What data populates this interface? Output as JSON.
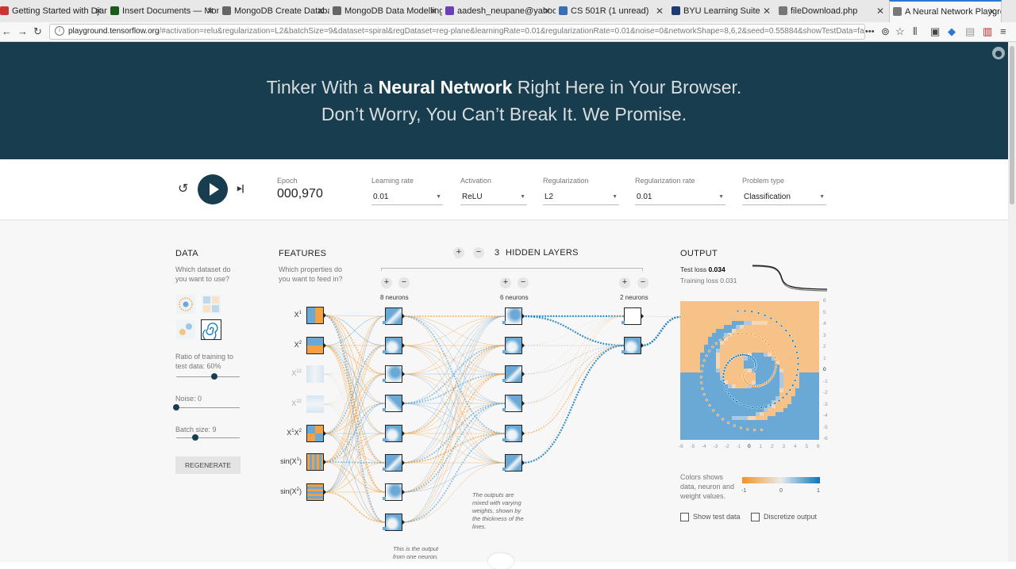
{
  "browser": {
    "tabs": [
      {
        "title": "Getting Started with Djang",
        "color": "#c33"
      },
      {
        "title": "Insert Documents — Mong",
        "color": "#1a5b1a"
      },
      {
        "title": "MongoDB Create Databas",
        "color": "#666"
      },
      {
        "title": "MongoDB Data Modelling",
        "color": "#666"
      },
      {
        "title": "aadesh_neupane@yahoo.c",
        "color": "#6b3fb5"
      },
      {
        "title": "CS 501R (1 unread)",
        "color": "#3b6db3"
      },
      {
        "title": "BYU Learning Suite",
        "color": "#1d3b70"
      },
      {
        "title": "fileDownload.php",
        "color": "#777"
      },
      {
        "title": "A Neural Network Playgro",
        "color": "#777"
      }
    ],
    "url_host": "playground.tensorflow.org",
    "url_rest": "/#activation=relu&regularization=L2&batchSize=9&dataset=spiral&regDataset=reg-plane&learningRate=0.01&regularizationRate=0.01&noise=0&networkShape=8,6,2&seed=0.55884&showTestData=false&discretize=false&percTrain"
  },
  "hero": {
    "line1_pre": "Tinker With a ",
    "line1_bold": "Neural Network",
    "line1_post": " Right Here in Your Browser.",
    "line2": "Don’t Worry, You Can’t Break It. We Promise."
  },
  "controls": {
    "epoch_label": "Epoch",
    "epoch_value": "000,970",
    "learning_rate": {
      "label": "Learning rate",
      "value": "0.01"
    },
    "activation": {
      "label": "Activation",
      "value": "ReLU"
    },
    "regularization": {
      "label": "Regularization",
      "value": "L2"
    },
    "regularization_rate": {
      "label": "Regularization rate",
      "value": "0.01"
    },
    "problem_type": {
      "label": "Problem type",
      "value": "Classification"
    }
  },
  "data_panel": {
    "title": "DATA",
    "question": "Which dataset do you want to use?",
    "ratio_label": "Ratio of training to test data:  60%",
    "ratio_value": 0.6,
    "noise_label": "Noise:  0",
    "noise_value": 0,
    "batch_label": "Batch size:  9",
    "batch_value": 0.3,
    "regenerate": "REGENERATE"
  },
  "features_panel": {
    "title": "FEATURES",
    "question": "Which properties do you want to feed in?",
    "features": [
      {
        "main": "X",
        "sup": "1",
        "tail": "",
        "sup2": "",
        "active": true
      },
      {
        "main": "X",
        "sup": "2",
        "tail": "",
        "sup2": "",
        "active": true
      },
      {
        "main": "X",
        "sup": "12",
        "tail": "",
        "sup2": "",
        "active": false
      },
      {
        "main": "X",
        "sup": "22",
        "tail": "",
        "sup2": "",
        "active": false
      },
      {
        "main": "X",
        "sup": "1",
        "tail": "X",
        "sup2": "2",
        "active": true
      },
      {
        "main": "sin(X",
        "sup": "1",
        "tail": ")",
        "sup2": "",
        "active": true
      },
      {
        "main": "sin(X",
        "sup": "2",
        "tail": ")",
        "sup2": "",
        "active": true
      }
    ]
  },
  "network": {
    "hidden_layers_count": "3",
    "hidden_layers_label": "HIDDEN LAYERS",
    "plus": "+",
    "minus": "−",
    "layers": [
      {
        "label": "8 neurons",
        "count": 8
      },
      {
        "label": "6 neurons",
        "count": 6
      },
      {
        "label": "2 neurons",
        "count": 2
      }
    ],
    "note_outputs": "The outputs are mixed with varying weights, shown by the thickness of the lines.",
    "note_neuron": "This is the output from one neuron."
  },
  "output_panel": {
    "title": "OUTPUT",
    "test_loss_label": "Test loss ",
    "test_loss": "0.034",
    "training_loss_label": "Training loss ",
    "training_loss": "0.031",
    "y_ticks": [
      "6",
      "5",
      "4",
      "3",
      "2",
      "1",
      "0",
      "-1",
      "-2",
      "-3",
      "-4",
      "-5",
      "-6"
    ],
    "x_ticks": [
      "-6",
      "-5",
      "-4",
      "-3",
      "-2",
      "-1",
      "0",
      "1",
      "2",
      "3",
      "4",
      "5",
      "6"
    ],
    "legend_text": "Colors shows data, neuron and weight values.",
    "legend_min": "-1",
    "legend_mid": "0",
    "legend_max": "1",
    "show_test_data": "Show test data",
    "discretize_output": "Discretize output"
  },
  "colors": {
    "header_bg": "#183d4e",
    "orange": "#f5a142",
    "blue": "#0877bd",
    "light_blue": "#6aa8d6",
    "light_orange": "#f7c287"
  }
}
